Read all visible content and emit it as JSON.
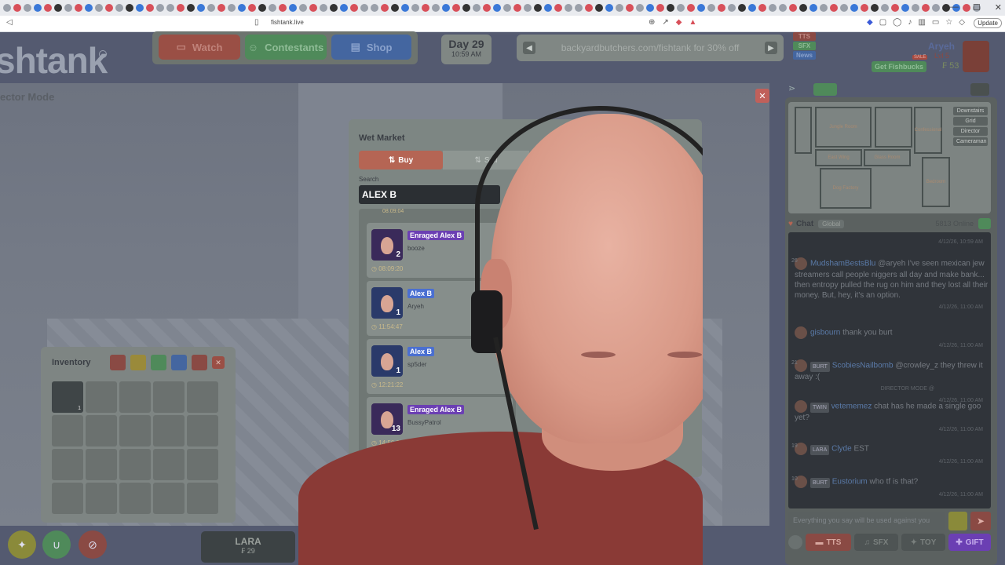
{
  "browser": {
    "url": "fishtank.live",
    "update_label": "Update"
  },
  "site": {
    "logo": "shtank",
    "nav": {
      "watch": "Watch",
      "contestants": "Contestants",
      "shop": "Shop"
    },
    "day": "Day 29",
    "time": "10:59 AM",
    "promo": "backyardbutchers.com/fishtank for 30% off",
    "mini": {
      "tts": "TTS",
      "sfx": "SFX",
      "news": "News"
    },
    "user": {
      "name": "Aryeh",
      "level": "Lvl 5",
      "balance": "₣ 53"
    },
    "get_fishbucks": "Get Fishbucks",
    "sale_badge": "SALE",
    "mode_label": "ector Mode",
    "lara": {
      "name": "LARA",
      "price": "₣ 29"
    }
  },
  "inventory": {
    "title": "Inventory",
    "first_count": "1"
  },
  "market": {
    "title": "Wet Market",
    "buy_label": "Buy",
    "sell_label": "Sell",
    "search_label": "Search",
    "search_value": "ALEX B",
    "partial_time": "08:09:04",
    "items": [
      {
        "name": "Enraged Alex B",
        "seller": "booze",
        "count": "2",
        "time": "08:09:20",
        "color": "#6b3fb3"
      },
      {
        "name": "Alex B",
        "seller": "Aryeh",
        "count": "1",
        "time": "11:54:47",
        "color": "#4a6fd1"
      },
      {
        "name": "Alex B",
        "seller": "sp5der",
        "count": "1",
        "time": "12:21:22",
        "color": "#4a6fd1"
      },
      {
        "name": "Enraged Alex B",
        "seller": "BussyPatrol",
        "count": "13",
        "time": "14:56:23",
        "color": "#6b3fb3"
      }
    ]
  },
  "map": {
    "nav": [
      "Downstairs",
      "Grid",
      "Director",
      "Cameraman"
    ],
    "rooms": [
      "Jungle Room",
      "Confessional",
      "Foyer",
      "Glass Room",
      "East Wing",
      "Dog Factory",
      "Bedroom"
    ]
  },
  "chat": {
    "title": "Chat",
    "tab": "Global",
    "online": "5813 Online",
    "messages": [
      {
        "user": "",
        "text": "",
        "time": "4/12/26, 10:59 AM"
      },
      {
        "level": "26",
        "user": "MudshamBestsBlu",
        "text": "@aryeh I've seen mexican jew streamers call people niggers all day and make bank... then entropy pulled the rug on him and they lost all their money. But, hey, it's an option.",
        "time": "4/12/26, 11:00 AM"
      },
      {
        "level": "",
        "user": "gisbourn",
        "text": "thank you burt",
        "time": "4/12/26, 11:00 AM"
      },
      {
        "level": "21",
        "badge": "BURT",
        "user": "ScobiesNailbomb",
        "text": "@crowley_z they threw it away :(",
        "time": "4/12/26, 11:00 AM",
        "mode": "DIRECTOR MODE @"
      },
      {
        "level": "",
        "badge": "TWIN",
        "user": "vetememez",
        "text": "chat has he made a single goo yet?",
        "time": "4/12/26, 11:00 AM"
      },
      {
        "level": "19",
        "badge": "LARA",
        "user": "Clyde",
        "text": "EST",
        "time": "4/12/26, 11:00 AM"
      },
      {
        "level": "10",
        "badge": "BURT",
        "user": "Eustorium",
        "text": "who tf is that?",
        "time": "4/12/26, 11:00 AM"
      }
    ],
    "input_placeholder": "Everything you say will be used against you",
    "buttons": {
      "tts": "TTS",
      "sfx": "SFX",
      "toy": "TOY",
      "gift": "GIFT"
    }
  },
  "colors": {
    "accent": "#b56554",
    "watch": "#9a4f45",
    "contestants": "#4f8a5a",
    "shop": "#4466a0"
  }
}
